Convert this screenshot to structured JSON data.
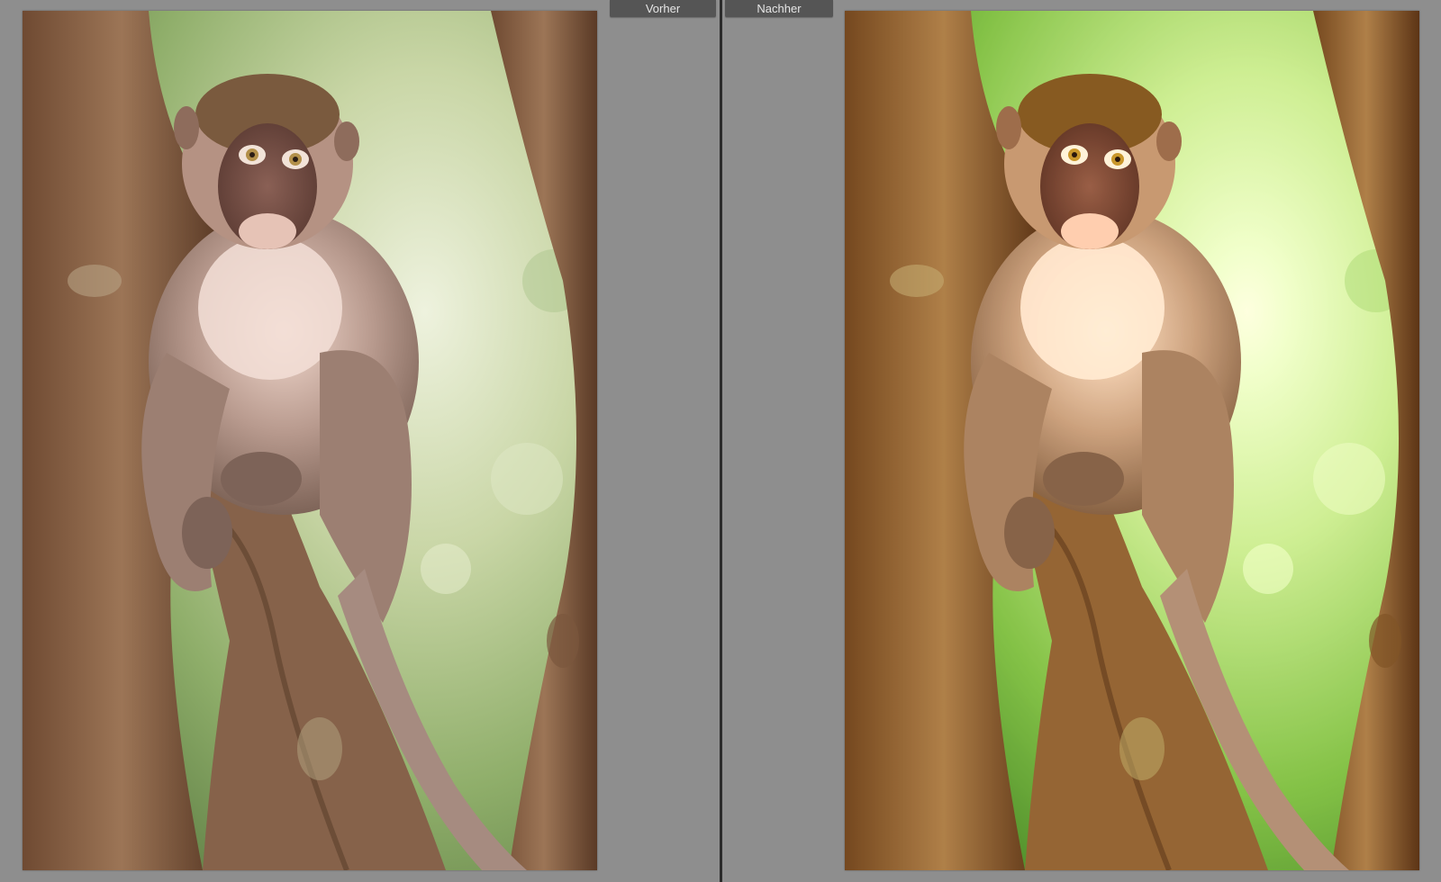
{
  "compare": {
    "before_label": "Vorher",
    "after_label": "Nachher"
  },
  "colors": {
    "workspace": "#8e8e8e",
    "tab_background": "#555555",
    "tab_text": "#e6e6e6",
    "divider": "#2b2b2b"
  }
}
